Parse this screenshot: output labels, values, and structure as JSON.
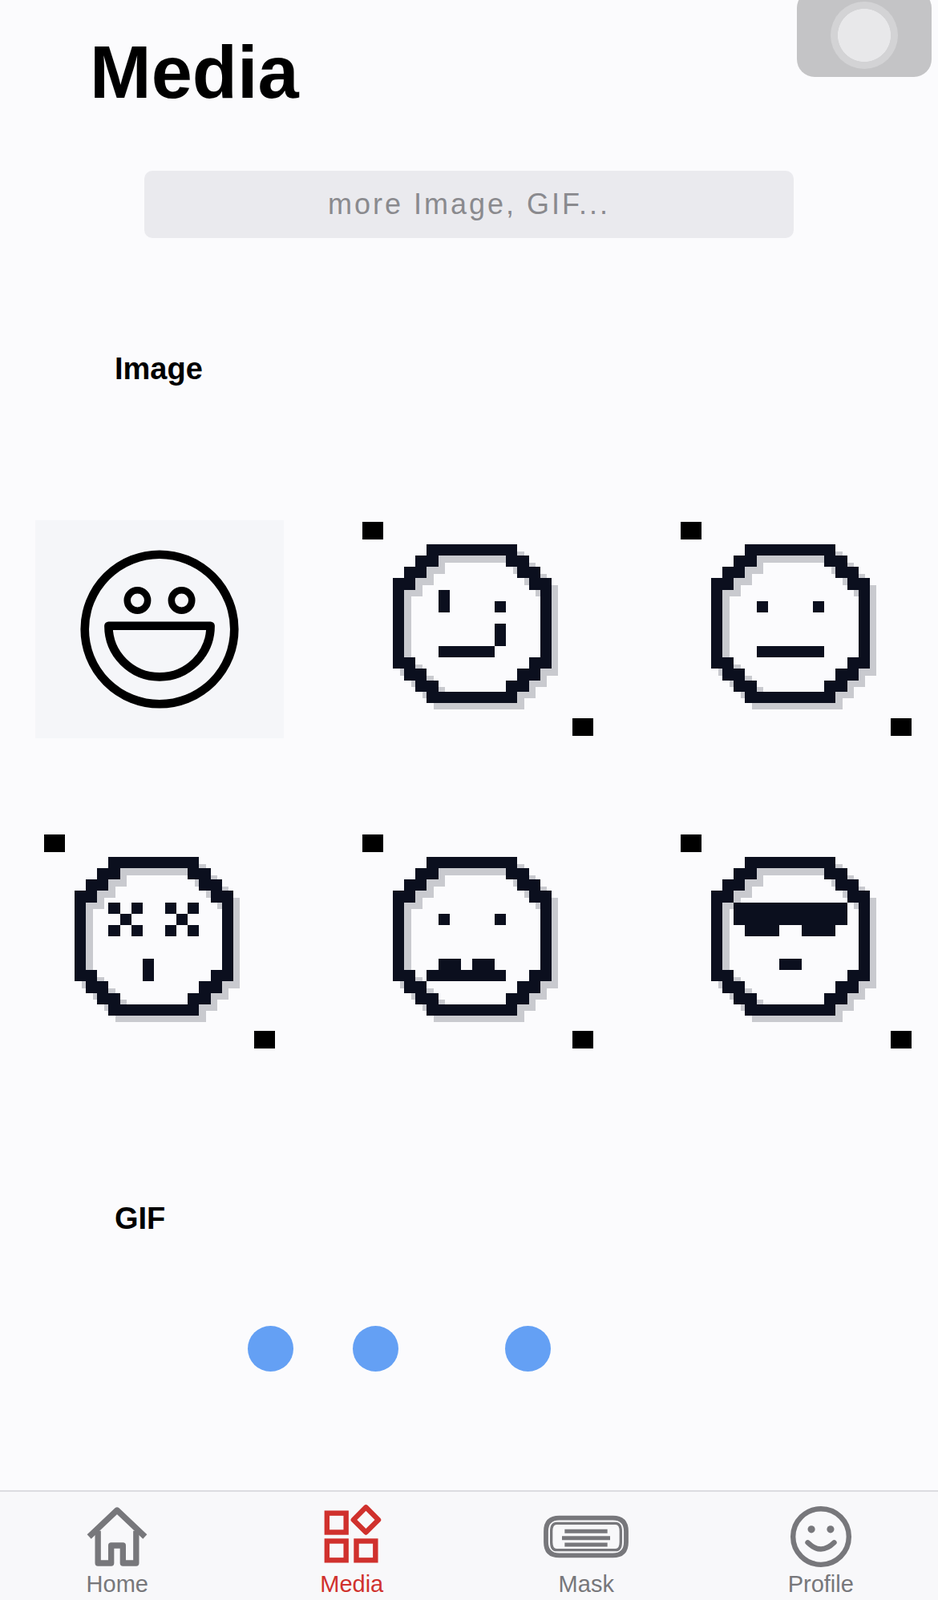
{
  "header": {
    "title": "Media"
  },
  "search": {
    "placeholder": "more Image, GIF..."
  },
  "image_section": {
    "label": "Image",
    "items": [
      {
        "kind": "grin",
        "framed": false
      },
      {
        "kind": "wink",
        "framed": true
      },
      {
        "kind": "neutral",
        "framed": true
      },
      {
        "kind": "dizzy",
        "framed": true
      },
      {
        "kind": "sad",
        "framed": true
      },
      {
        "kind": "cool",
        "framed": true
      }
    ]
  },
  "gif_section": {
    "label": "GIF",
    "loading": true
  },
  "tabs": [
    {
      "label": "Home",
      "icon": "home",
      "selected": false
    },
    {
      "label": "Media",
      "icon": "media",
      "selected": true
    },
    {
      "label": "Mask",
      "icon": "mask",
      "selected": false
    },
    {
      "label": "Profile",
      "icon": "profile",
      "selected": false
    }
  ]
}
